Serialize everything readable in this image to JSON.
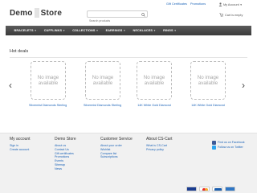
{
  "header": {
    "logo_part1": "Demo",
    "logo_part2": "Store",
    "search_placeholder": "Search products",
    "top_links": [
      "Gift Certificates",
      "Promotions"
    ],
    "account_label": "My Account",
    "cart_label": "Cart is empty"
  },
  "nav": {
    "items": [
      "BRACELETS",
      "CUFFLINKS",
      "COLLECTIONS",
      "EARRINGS",
      "NECKLACES",
      "RINGS"
    ]
  },
  "hot_deals": {
    "title": "Hot deals",
    "products": [
      {
        "placeholder": "No image available",
        "name": "Silvermist Diamonds Sterling Silver"
      },
      {
        "placeholder": "No image available",
        "name": "Silvermist Diamonds Sterling Silver"
      },
      {
        "placeholder": "No image available",
        "name": "14K White Gold Diamond"
      },
      {
        "placeholder": "No image available",
        "name": "14K White Gold Diamond"
      }
    ]
  },
  "footer": {
    "my_account": {
      "title": "My account",
      "links": [
        "Sign in",
        "Create account"
      ]
    },
    "demo_store": {
      "title": "Demo Store",
      "links": [
        "About us",
        "Contact Us",
        "Gift certificates",
        "Promotions",
        "Events",
        "Sitemap",
        "News"
      ]
    },
    "customer_service": {
      "title": "Customer Service",
      "links": [
        "About your order",
        "Wishlist",
        "Compare list",
        "Subscriptions"
      ]
    },
    "about_cs_cart": {
      "title": "About CS-Cart",
      "links": [
        "What is CS-Cart",
        "Privacy policy"
      ]
    },
    "social": [
      "Find us on Facebook",
      "Follow us on Twitter"
    ]
  },
  "colors": {
    "link": "#1a62b7",
    "nav_bg": "#464646",
    "footer_bg": "#f1f1f1"
  },
  "icons": {
    "search": "search-icon",
    "account": "user-icon",
    "cart": "cart-icon",
    "prev": "chevron-left-icon",
    "next": "chevron-right-icon"
  }
}
